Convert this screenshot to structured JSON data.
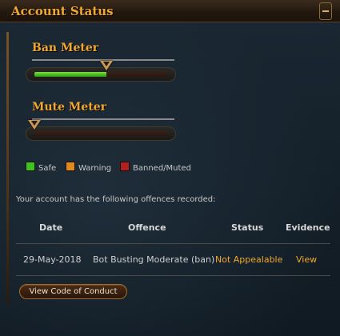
{
  "window": {
    "title": "Account Status"
  },
  "ban_meter": {
    "label": "Ban Meter",
    "level_percent": 54
  },
  "mute_meter": {
    "label": "Mute Meter",
    "level_percent": 0
  },
  "legend": [
    {
      "label": "Safe",
      "color": "#3cc31e"
    },
    {
      "label": "Warning",
      "color": "#e08a1a"
    },
    {
      "label": "Banned/Muted",
      "color": "#b41e1e"
    }
  ],
  "intro_text": "Your account has the following offences recorded:",
  "table": {
    "headers": [
      "Date",
      "Offence",
      "Status",
      "Evidence"
    ],
    "rows": [
      {
        "date": "29-May-2018",
        "offence": "Bot Busting Moderate (ban)",
        "status": "Not Appealable",
        "evidence": "View"
      }
    ]
  },
  "buttons": {
    "code_of_conduct": "View Code of Conduct"
  },
  "colors": {
    "accent": "#f0a830"
  }
}
